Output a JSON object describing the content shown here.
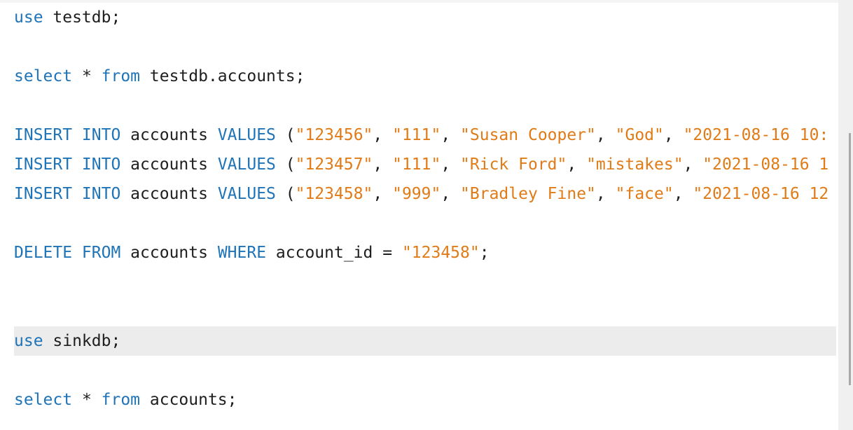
{
  "editor": {
    "lines": [
      [
        {
          "t": "kw",
          "v": "use"
        },
        {
          "t": "pl",
          "v": " testdb;"
        }
      ],
      [],
      [
        {
          "t": "kw",
          "v": "select"
        },
        {
          "t": "pl",
          "v": " * "
        },
        {
          "t": "kw",
          "v": "from"
        },
        {
          "t": "pl",
          "v": " testdb.accounts;"
        }
      ],
      [],
      [
        {
          "t": "kw",
          "v": "INSERT INTO"
        },
        {
          "t": "pl",
          "v": " accounts "
        },
        {
          "t": "kw",
          "v": "VALUES"
        },
        {
          "t": "pl",
          "v": " ("
        },
        {
          "t": "str",
          "v": "\"123456\""
        },
        {
          "t": "pl",
          "v": ", "
        },
        {
          "t": "str",
          "v": "\"111\""
        },
        {
          "t": "pl",
          "v": ", "
        },
        {
          "t": "str",
          "v": "\"Susan Cooper\""
        },
        {
          "t": "pl",
          "v": ", "
        },
        {
          "t": "str",
          "v": "\"God\""
        },
        {
          "t": "pl",
          "v": ", "
        },
        {
          "t": "str",
          "v": "\"2021-08-16 10:"
        }
      ],
      [
        {
          "t": "kw",
          "v": "INSERT INTO"
        },
        {
          "t": "pl",
          "v": " accounts "
        },
        {
          "t": "kw",
          "v": "VALUES"
        },
        {
          "t": "pl",
          "v": " ("
        },
        {
          "t": "str",
          "v": "\"123457\""
        },
        {
          "t": "pl",
          "v": ", "
        },
        {
          "t": "str",
          "v": "\"111\""
        },
        {
          "t": "pl",
          "v": ", "
        },
        {
          "t": "str",
          "v": "\"Rick Ford\""
        },
        {
          "t": "pl",
          "v": ", "
        },
        {
          "t": "str",
          "v": "\"mistakes\""
        },
        {
          "t": "pl",
          "v": ", "
        },
        {
          "t": "str",
          "v": "\"2021-08-16 1"
        }
      ],
      [
        {
          "t": "kw",
          "v": "INSERT INTO"
        },
        {
          "t": "pl",
          "v": " accounts "
        },
        {
          "t": "kw",
          "v": "VALUES"
        },
        {
          "t": "pl",
          "v": " ("
        },
        {
          "t": "str",
          "v": "\"123458\""
        },
        {
          "t": "pl",
          "v": ", "
        },
        {
          "t": "str",
          "v": "\"999\""
        },
        {
          "t": "pl",
          "v": ", "
        },
        {
          "t": "str",
          "v": "\"Bradley Fine\""
        },
        {
          "t": "pl",
          "v": ", "
        },
        {
          "t": "str",
          "v": "\"face\""
        },
        {
          "t": "pl",
          "v": ", "
        },
        {
          "t": "str",
          "v": "\"2021-08-16 12"
        }
      ],
      [],
      [
        {
          "t": "kw",
          "v": "DELETE FROM"
        },
        {
          "t": "pl",
          "v": " accounts "
        },
        {
          "t": "kw",
          "v": "WHERE"
        },
        {
          "t": "pl",
          "v": " account_id = "
        },
        {
          "t": "str",
          "v": "\"123458\""
        },
        {
          "t": "pl",
          "v": ";"
        }
      ],
      [],
      [],
      [
        {
          "t": "kw",
          "v": "use"
        },
        {
          "t": "pl",
          "v": " sinkdb;"
        }
      ],
      [],
      [
        {
          "t": "kw",
          "v": "select"
        },
        {
          "t": "pl",
          "v": " * "
        },
        {
          "t": "kw",
          "v": "from"
        },
        {
          "t": "pl",
          "v": " accounts;"
        }
      ]
    ],
    "current_line_index": 11
  },
  "colors": {
    "keyword": "#1f74b8",
    "string": "#e07b17",
    "plain": "#1e1e1e",
    "current_line_bg": "#ececec",
    "background": "#ffffff"
  }
}
